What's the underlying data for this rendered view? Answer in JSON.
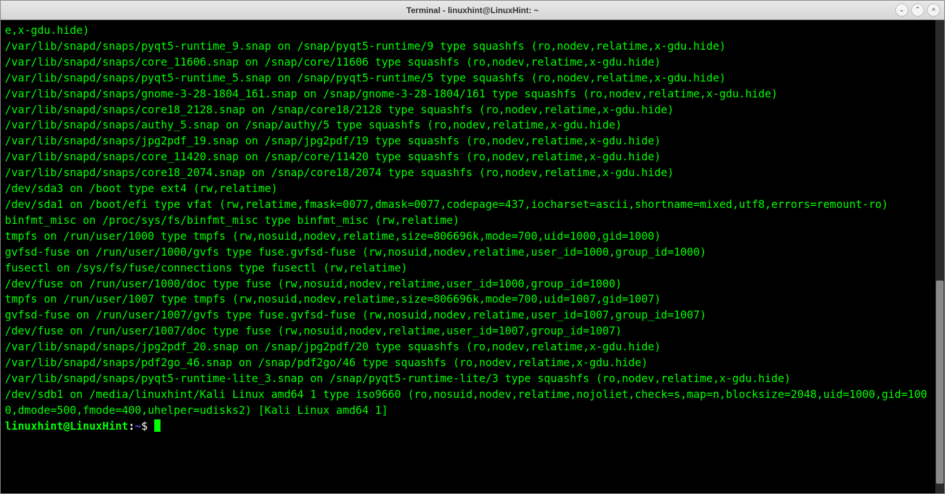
{
  "window": {
    "title": "Terminal - linuxhint@LinuxHint: ~"
  },
  "titlebar": {
    "minimize_glyph": "⌄",
    "maximize_glyph": "⌃",
    "close_glyph": "×"
  },
  "terminal": {
    "lines": [
      "e,x-gdu.hide)",
      "/var/lib/snapd/snaps/pyqt5-runtime_9.snap on /snap/pyqt5-runtime/9 type squashfs (ro,nodev,relatime,x-gdu.hide)",
      "/var/lib/snapd/snaps/core_11606.snap on /snap/core/11606 type squashfs (ro,nodev,relatime,x-gdu.hide)",
      "/var/lib/snapd/snaps/pyqt5-runtime_5.snap on /snap/pyqt5-runtime/5 type squashfs (ro,nodev,relatime,x-gdu.hide)",
      "/var/lib/snapd/snaps/gnome-3-28-1804_161.snap on /snap/gnome-3-28-1804/161 type squashfs (ro,nodev,relatime,x-gdu.hide)",
      "/var/lib/snapd/snaps/core18_2128.snap on /snap/core18/2128 type squashfs (ro,nodev,relatime,x-gdu.hide)",
      "/var/lib/snapd/snaps/authy_5.snap on /snap/authy/5 type squashfs (ro,nodev,relatime,x-gdu.hide)",
      "/var/lib/snapd/snaps/jpg2pdf_19.snap on /snap/jpg2pdf/19 type squashfs (ro,nodev,relatime,x-gdu.hide)",
      "/var/lib/snapd/snaps/core_11420.snap on /snap/core/11420 type squashfs (ro,nodev,relatime,x-gdu.hide)",
      "/var/lib/snapd/snaps/core18_2074.snap on /snap/core18/2074 type squashfs (ro,nodev,relatime,x-gdu.hide)",
      "/dev/sda3 on /boot type ext4 (rw,relatime)",
      "/dev/sda1 on /boot/efi type vfat (rw,relatime,fmask=0077,dmask=0077,codepage=437,iocharset=ascii,shortname=mixed,utf8,errors=remount-ro)",
      "binfmt_misc on /proc/sys/fs/binfmt_misc type binfmt_misc (rw,relatime)",
      "tmpfs on /run/user/1000 type tmpfs (rw,nosuid,nodev,relatime,size=806696k,mode=700,uid=1000,gid=1000)",
      "gvfsd-fuse on /run/user/1000/gvfs type fuse.gvfsd-fuse (rw,nosuid,nodev,relatime,user_id=1000,group_id=1000)",
      "fusectl on /sys/fs/fuse/connections type fusectl (rw,relatime)",
      "/dev/fuse on /run/user/1000/doc type fuse (rw,nosuid,nodev,relatime,user_id=1000,group_id=1000)",
      "tmpfs on /run/user/1007 type tmpfs (rw,nosuid,nodev,relatime,size=806696k,mode=700,uid=1007,gid=1007)",
      "gvfsd-fuse on /run/user/1007/gvfs type fuse.gvfsd-fuse (rw,nosuid,nodev,relatime,user_id=1007,group_id=1007)",
      "/dev/fuse on /run/user/1007/doc type fuse (rw,nosuid,nodev,relatime,user_id=1007,group_id=1007)",
      "/var/lib/snapd/snaps/jpg2pdf_20.snap on /snap/jpg2pdf/20 type squashfs (ro,nodev,relatime,x-gdu.hide)",
      "/var/lib/snapd/snaps/pdf2go_46.snap on /snap/pdf2go/46 type squashfs (ro,nodev,relatime,x-gdu.hide)",
      "/var/lib/snapd/snaps/pyqt5-runtime-lite_3.snap on /snap/pyqt5-runtime-lite/3 type squashfs (ro,nodev,relatime,x-gdu.hide)",
      "/dev/sdb1 on /media/linuxhint/Kali Linux amd64 1 type iso9660 (ro,nosuid,nodev,relatime,nojoliet,check=s,map=n,blocksize=2048,uid=1000,gid=1000,dmode=500,fmode=400,uhelper=udisks2) [Kali Linux amd64 1]"
    ],
    "prompt": {
      "user_host": "linuxhint@LinuxHint",
      "separator": ":",
      "path": "~",
      "dollar": "$ "
    }
  }
}
